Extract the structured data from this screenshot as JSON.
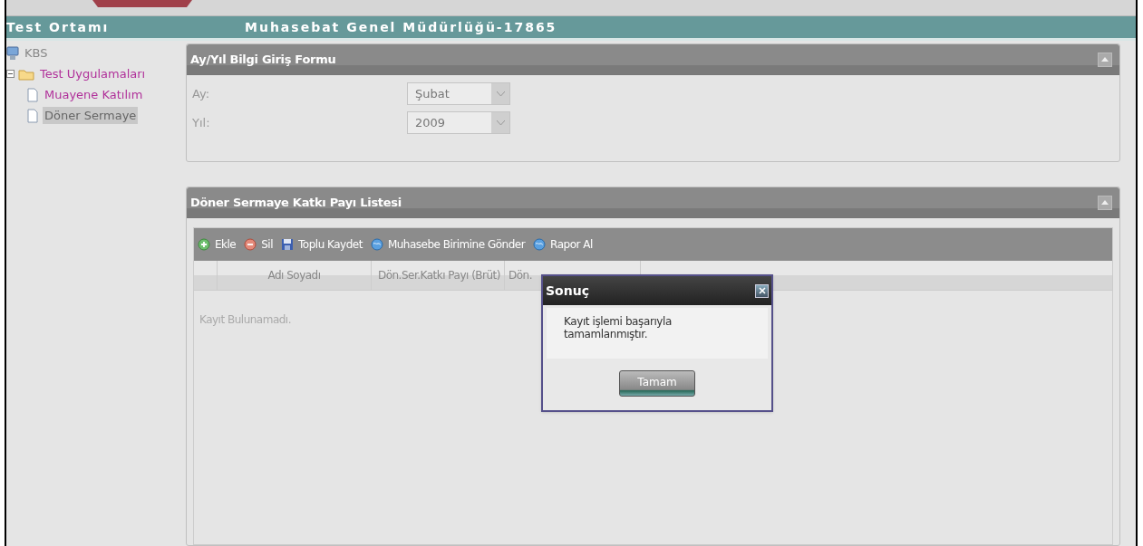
{
  "header": {
    "left_title": "Test Ortamı",
    "center_title": "Muhasebat Genel Müdürlüğü-17865"
  },
  "tree": [
    {
      "label": "KBS",
      "kind": "root",
      "children": [
        {
          "label": "Test Uygulamaları",
          "kind": "folder",
          "expanded": true,
          "children": [
            {
              "label": "Muayene Katılım",
              "kind": "page",
              "selected": false
            },
            {
              "label": "Döner Sermaye",
              "kind": "page",
              "selected": true
            }
          ]
        }
      ]
    }
  ],
  "form_panel": {
    "title": "Ay/Yıl Bilgi Giriş Formu",
    "fields": [
      {
        "label": "Ay:",
        "value": "Şubat"
      },
      {
        "label": "Yıl:",
        "value": "2009"
      }
    ]
  },
  "list_panel": {
    "title": "Döner Sermaye Katkı Payı Listesi",
    "toolbar": [
      {
        "label": "Ekle",
        "kind": "add"
      },
      {
        "label": "Sil",
        "kind": "delete"
      },
      {
        "label": "Toplu Kaydet",
        "kind": "save"
      },
      {
        "label": "Muhasebe Birimine Gönder",
        "kind": "globe"
      },
      {
        "label": "Rapor Al",
        "kind": "globe"
      }
    ],
    "columns": [
      "Adı Soyadı",
      "Dön.Ser.Katkı Payı (Brüt)",
      "Dön."
    ],
    "empty_text": "Kayıt Bulunamadı."
  },
  "dialog": {
    "title": "Sonuç",
    "message": "Kayıt işlemi başarıyla tamamlanmıştır.",
    "button": "Tamam"
  }
}
